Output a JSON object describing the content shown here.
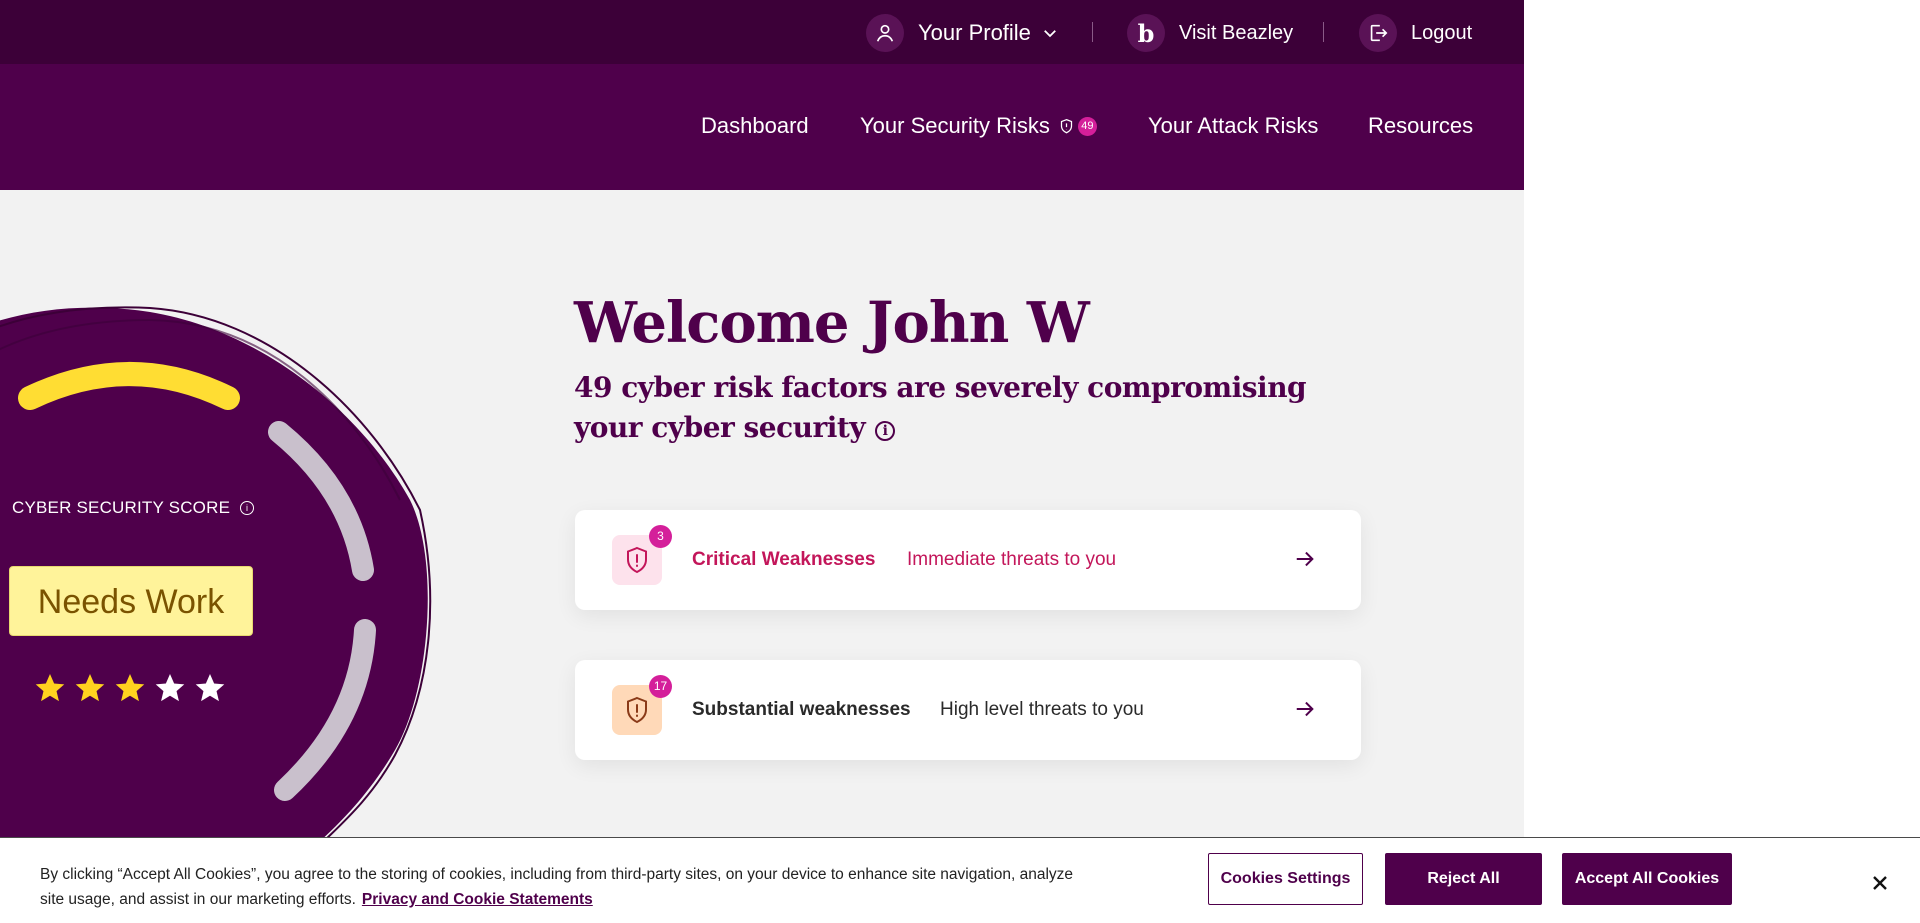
{
  "topbar": {
    "profile_label": "Your Profile",
    "visit_label": "Visit Beazley",
    "visit_logo_letter": "b",
    "logout_label": "Logout",
    "icons": [
      "user-icon",
      "chevron-down-icon",
      "beazley-logo-icon",
      "logout-icon"
    ]
  },
  "nav": {
    "items": [
      {
        "label": "Dashboard"
      },
      {
        "label": "Your Security Risks",
        "badge": "49",
        "icon": "shield-alert-icon"
      },
      {
        "label": "Your Attack Risks"
      },
      {
        "label": "Resources"
      }
    ]
  },
  "main": {
    "welcome": "Welcome John W",
    "subheading": "49 cyber risk factors are severely compromising your cyber security",
    "info_glyph": "i"
  },
  "score": {
    "label": "CYBER SECURITY SCORE",
    "info_glyph": "i",
    "rating": "Needs Work",
    "stars_filled": 3,
    "stars_total": 5,
    "colors": {
      "circle": "#4f004b",
      "gauge_active": "#ffdd33",
      "gauge_inactive": "#c9c0cc",
      "star_filled": "#ffd21f",
      "star_empty": "#ffffff"
    }
  },
  "cards": [
    {
      "count": "3",
      "title": "Critical Weaknesses",
      "subtitle": "Immediate threats to you",
      "icon": "shield-alert-icon",
      "colors": {
        "text": "#c3165a",
        "icon_bg": "#fde2ec",
        "icon_fg": "#c3165a"
      }
    },
    {
      "count": "17",
      "title": "Substantial weaknesses",
      "subtitle": "High level threats to you",
      "icon": "shield-alert-icon",
      "colors": {
        "text": "#2a2a2a",
        "icon_bg": "#ffd9b8",
        "icon_fg": "#8a3a18"
      }
    }
  ],
  "cookie": {
    "text": "By clicking “Accept All Cookies”, you agree to the storing of cookies, including from third-party sites, on your device to enhance site navigation, analyze site usage, and assist in our marketing efforts.",
    "link": "Privacy and Cookie Statements",
    "settings_label": "Cookies Settings",
    "reject_label": "Reject All",
    "accept_label": "Accept All Cookies",
    "close_icon": "close-icon"
  },
  "colors": {
    "topbar": "#3c0038",
    "nav": "#4f004b",
    "brand": "#4f004b",
    "badge": "#d41f9a",
    "page_bg": "#f2f2f2"
  }
}
